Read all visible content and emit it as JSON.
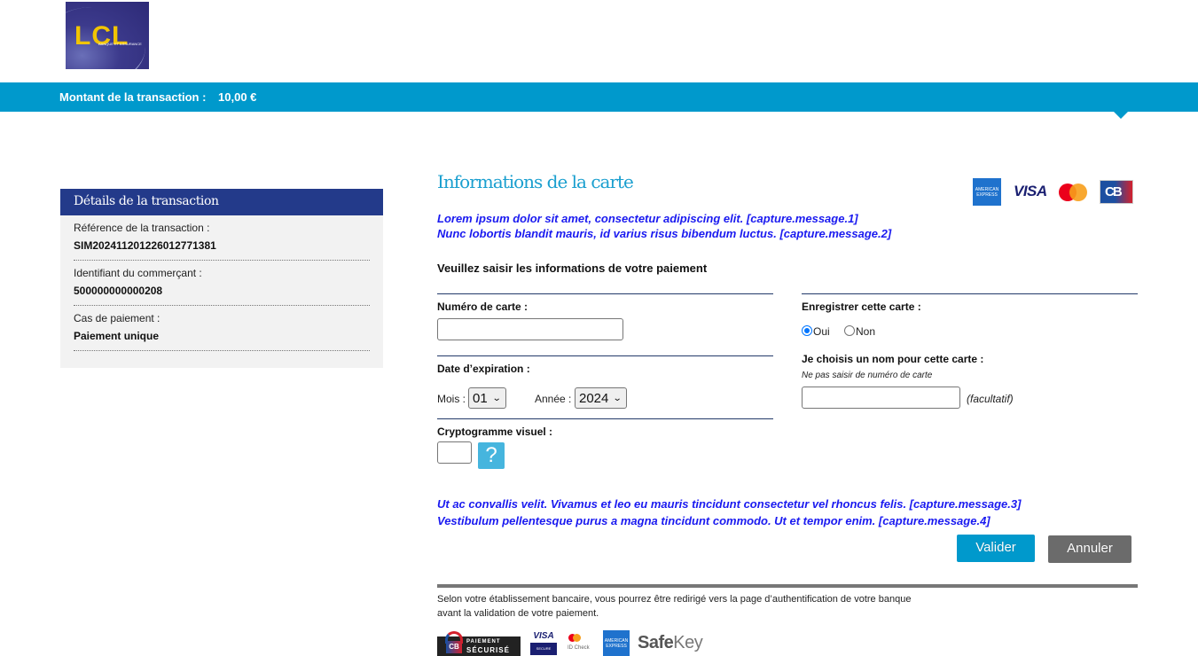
{
  "header": {
    "logo": {
      "text": "LCL",
      "subtext": "BANQUE ET ASSURANCE"
    },
    "amount_label": "Montant de la transaction  :",
    "amount_value": "10,00 €"
  },
  "details": {
    "title": "Détails de la transaction",
    "items": [
      {
        "label": "Référence de la transaction :",
        "value": "SIM202411201226012771381"
      },
      {
        "label": "Identifiant du commerçant :",
        "value": "500000000000208"
      },
      {
        "label": "Cas de paiement :",
        "value": "Paiement unique"
      }
    ]
  },
  "main": {
    "title": "Informations de la carte",
    "card_brands": [
      "American Express",
      "VISA",
      "Mastercard",
      "CB"
    ],
    "messages_top": [
      "Lorem ipsum dolor sit amet, consectetur adipiscing elit. [capture.message.1]",
      "Nunc lobortis blandit mauris, id varius risus bibendum luctus. [capture.message.2]"
    ],
    "instruction": "Veuillez saisir les informations de votre paiement",
    "card_number": {
      "label": "Numéro de carte :",
      "value": ""
    },
    "expiry": {
      "label": "Date d’expiration :",
      "month_label": "Mois :",
      "month_value": "01",
      "year_label": "Année :",
      "year_value": "2024"
    },
    "cvv": {
      "label": "Cryptogramme visuel :",
      "value": "",
      "help_symbol": "?"
    },
    "save_card": {
      "label": "Enregistrer cette carte :",
      "options": [
        {
          "label": "Oui",
          "checked": true
        },
        {
          "label": "Non",
          "checked": false
        }
      ]
    },
    "card_name": {
      "label": "Je choisis un nom pour cette carte :",
      "hint": "Ne pas saisir de numéro de carte",
      "value": "",
      "optional_label": "(facultatif)"
    },
    "messages_bottom": [
      "Ut ac convallis velit. Vivamus et leo eu mauris tincidunt consectetur vel rhoncus felis. [capture.message.3]",
      "Vestibulum pellentesque purus a magna tincidunt commodo. Ut et tempor enim. [capture.message.4]"
    ],
    "buttons": {
      "validate": "Valider",
      "cancel": "Annuler"
    }
  },
  "footer": {
    "notice_line1": "Selon votre établissement bancaire, vous pourrez être redirigé vers la page d’authentification de votre banque",
    "notice_line2": "avant la validation de votre paiement.",
    "badges": {
      "cb_line1": "PAIEMENT",
      "cb_line2": "SÉCURISÉ",
      "visa_top": "VISA",
      "visa_bottom": "SECURE",
      "mc_text": "ID Check",
      "amex_text": "AMERICAN EXPRESS",
      "safekey_bold": "Safe",
      "safekey_light": "Key"
    }
  },
  "colors": {
    "brand_blue": "#0099cc",
    "panel_header": "#233a8a",
    "message_blue": "#1a1af0",
    "title_blue": "#1a9fcf",
    "cancel_gray": "#6b6b6b"
  }
}
